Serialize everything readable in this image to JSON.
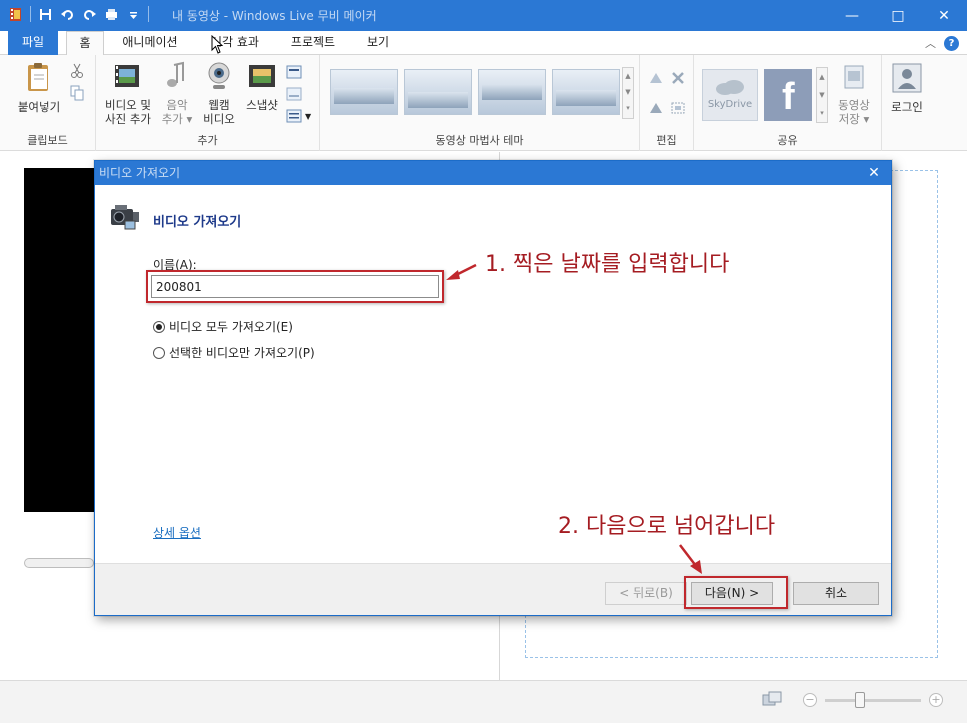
{
  "window": {
    "title": "내 동영상 - Windows Live 무비 메이커",
    "controls": {
      "minimize": "—",
      "maximize": "□",
      "close": "✕"
    }
  },
  "ribbon": {
    "tabs": [
      {
        "label": "파일"
      },
      {
        "label": "홈"
      },
      {
        "label": "애니메이션"
      },
      {
        "label": "시각 효과"
      },
      {
        "label": "프로젝트"
      },
      {
        "label": "보기"
      }
    ],
    "groups": {
      "clipboard": {
        "label": "클립보드",
        "paste": "붙여넣기"
      },
      "add": {
        "label": "추가",
        "add_video_line1": "비디오 및",
        "add_video_line2": "사진 추가",
        "music_line1": "음악",
        "music_line2": "추가 ▾",
        "webcam_line1": "웹캠",
        "webcam_line2": "비디오",
        "snapshot": "스냅샷",
        "small_caption": "캡션"
      },
      "themes": {
        "label": "동영상 마법사 테마"
      },
      "edit": {
        "label": "편집"
      },
      "share": {
        "label": "공유",
        "skydrive": "SkyDrive",
        "save_line1": "동영상",
        "save_line2": "저장 ▾"
      },
      "login": {
        "label": "로그인"
      }
    }
  },
  "dialog": {
    "title": "비디오 가져오기",
    "heading": "비디오 가져오기",
    "name_label": "이름(A):",
    "name_value": "200801",
    "radio_all": "비디오 모두 가져오기(E)",
    "radio_selected": "선택한 비디오만 가져오기(P)",
    "advanced_link": "상세 옵션",
    "back_button": "< 뒤로(B)",
    "next_button": "다음(N) >",
    "cancel_button": "취소"
  },
  "annotations": {
    "step1": "1. 찍은 날짜를 입력합니다",
    "step2": "2. 다음으로 넘어갑니다"
  },
  "colors": {
    "accent": "#2b78d4",
    "annotation_red": "#c0282d"
  }
}
